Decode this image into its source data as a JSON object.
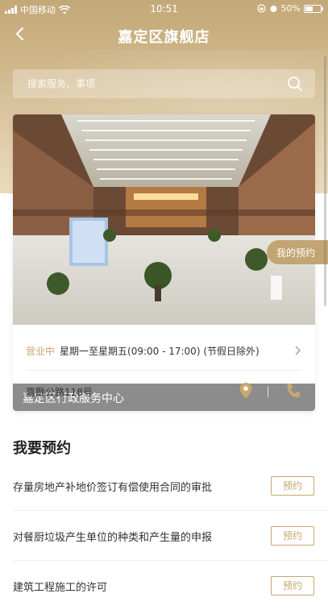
{
  "status_bar": {
    "carrier": "中国移动",
    "time": "10:51",
    "battery": "50%"
  },
  "nav": {
    "title": "嘉定区旗舰店"
  },
  "search": {
    "placeholder": "搜索服务、事项"
  },
  "center": {
    "name": "嘉定区行政服务中心",
    "open_status": "营业中",
    "hours": "星期一至星期五(09:00 - 17:00) (节假日除外)",
    "address": "嘉戬公路118号"
  },
  "my_appointment_label": "我的预约",
  "section": {
    "title": "我要预约"
  },
  "appointments": [
    {
      "name": "存量房地产补地价签订有偿使用合同的审批",
      "button": "预约"
    },
    {
      "name": "对餐厨垃圾产生单位的种类和产生量的申报",
      "button": "预约"
    },
    {
      "name": "建筑工程施工的许可",
      "button": "预约"
    }
  ],
  "colors": {
    "gold": "#c9a76c",
    "gold_bg": "#cdb588"
  },
  "icons": [
    "signal-icon",
    "wifi-icon",
    "battery-icon",
    "back-icon",
    "search-icon",
    "chevron-right-icon",
    "location-pin-icon",
    "phone-icon"
  ]
}
